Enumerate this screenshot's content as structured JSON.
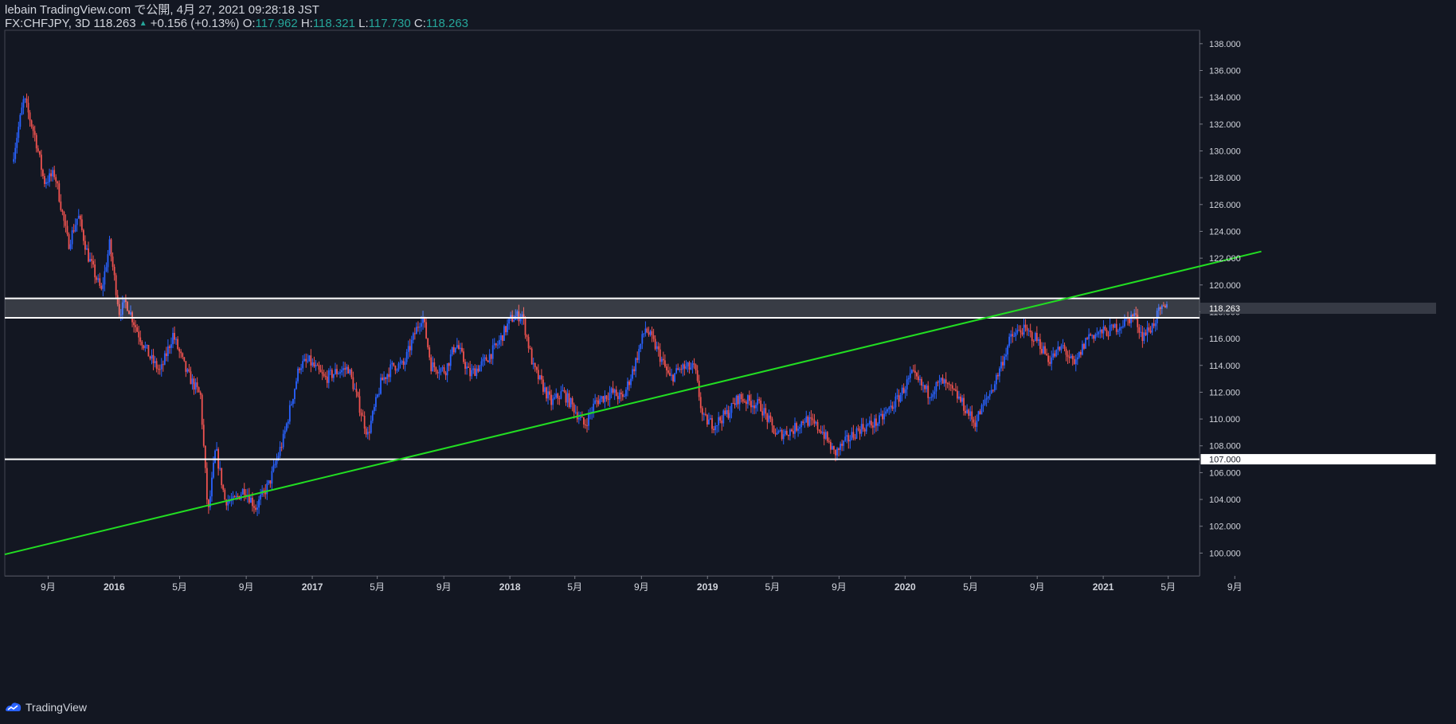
{
  "header": {
    "publish_line": "lebain TradingView.com で公開, 4月 27, 2021 09:28:18 JST",
    "symbol": "FX:CHFJPY, 3D",
    "last": "118.263",
    "change": "+0.156 (+0.13%)",
    "o_label": "O:",
    "o_value": "117.962",
    "h_label": "H:",
    "h_value": "118.321",
    "l_label": "L:",
    "l_value": "117.730",
    "c_label": "C:",
    "c_value": "118.263"
  },
  "brand": {
    "name": "TradingView"
  },
  "colors": {
    "background": "#131722",
    "up": "#2962ff",
    "down": "#ef5350",
    "trendline": "#22dd22",
    "zone": "#ffffff"
  },
  "chart_data": {
    "type": "candlestick",
    "title": "",
    "xlabel": "",
    "ylabel": "",
    "ylim": [
      98.3,
      139.0
    ],
    "y_ticks": [
      "138.000",
      "136.000",
      "134.000",
      "132.000",
      "130.000",
      "128.000",
      "126.000",
      "124.000",
      "122.000",
      "120.000",
      "118.000",
      "116.000",
      "114.000",
      "112.000",
      "110.000",
      "108.000",
      "106.000",
      "104.000",
      "102.000",
      "100.000"
    ],
    "x_ticks": [
      "9月",
      "2016",
      "5月",
      "9月",
      "2017",
      "5月",
      "9月",
      "2018",
      "5月",
      "9月",
      "2019",
      "5月",
      "9月",
      "2020",
      "5月",
      "9月",
      "2021",
      "5月",
      "9月"
    ],
    "x_tick_dates": [
      "2015-09",
      "2016-01",
      "2016-05",
      "2016-09",
      "2017-01",
      "2017-05",
      "2017-09",
      "2018-01",
      "2018-05",
      "2018-09",
      "2019-01",
      "2019-05",
      "2019-09",
      "2020-01",
      "2020-05",
      "2020-09",
      "2021-01",
      "2021-05",
      "2021-09"
    ],
    "price_path": [
      [
        "2015-06-28",
        129.2
      ],
      [
        "2015-07-20",
        133.9
      ],
      [
        "2015-08-10",
        131.0
      ],
      [
        "2015-08-26",
        127.7
      ],
      [
        "2015-09-15",
        128.3
      ],
      [
        "2015-10-10",
        123.0
      ],
      [
        "2015-10-28",
        125.2
      ],
      [
        "2015-11-15",
        122.2
      ],
      [
        "2015-12-10",
        119.5
      ],
      [
        "2015-12-25",
        123.0
      ],
      [
        "2016-01-12",
        118.0
      ],
      [
        "2016-01-25",
        118.7
      ],
      [
        "2016-02-15",
        116.5
      ],
      [
        "2016-03-10",
        114.5
      ],
      [
        "2016-03-28",
        113.5
      ],
      [
        "2016-04-20",
        116.3
      ],
      [
        "2016-05-15",
        113.5
      ],
      [
        "2016-06-10",
        111.7
      ],
      [
        "2016-06-24",
        102.8
      ],
      [
        "2016-07-08",
        107.8
      ],
      [
        "2016-07-25",
        104.0
      ],
      [
        "2016-08-10",
        103.8
      ],
      [
        "2016-08-30",
        104.8
      ],
      [
        "2016-09-20",
        103.4
      ],
      [
        "2016-10-15",
        105.2
      ],
      [
        "2016-11-10",
        108.5
      ],
      [
        "2016-12-10",
        114.0
      ],
      [
        "2016-12-28",
        114.3
      ],
      [
        "2017-01-25",
        113.0
      ],
      [
        "2017-02-15",
        113.5
      ],
      [
        "2017-03-10",
        113.8
      ],
      [
        "2017-04-15",
        108.8
      ],
      [
        "2017-05-10",
        112.8
      ],
      [
        "2017-06-01",
        114.0
      ],
      [
        "2017-06-20",
        114.0
      ],
      [
        "2017-07-12",
        116.5
      ],
      [
        "2017-07-25",
        117.8
      ],
      [
        "2017-08-10",
        114.0
      ],
      [
        "2017-09-05",
        113.6
      ],
      [
        "2017-09-25",
        115.7
      ],
      [
        "2017-10-20",
        113.3
      ],
      [
        "2017-11-15",
        114.2
      ],
      [
        "2017-12-10",
        115.5
      ],
      [
        "2018-01-05",
        117.5
      ],
      [
        "2018-01-25",
        117.8
      ],
      [
        "2018-02-15",
        113.8
      ],
      [
        "2018-03-20",
        111.2
      ],
      [
        "2018-04-10",
        112.0
      ],
      [
        "2018-05-01",
        110.8
      ],
      [
        "2018-05-20",
        109.5
      ],
      [
        "2018-06-10",
        111.3
      ],
      [
        "2018-07-10",
        112.0
      ],
      [
        "2018-07-30",
        111.5
      ],
      [
        "2018-08-20",
        113.9
      ],
      [
        "2018-09-10",
        116.8
      ],
      [
        "2018-09-30",
        115.3
      ],
      [
        "2018-10-25",
        113.0
      ],
      [
        "2018-11-15",
        113.8
      ],
      [
        "2018-12-10",
        113.8
      ],
      [
        "2018-12-25",
        110.0
      ],
      [
        "2019-01-15",
        109.6
      ],
      [
        "2019-02-10",
        110.5
      ],
      [
        "2019-03-01",
        111.6
      ],
      [
        "2019-04-10",
        111.0
      ],
      [
        "2019-05-10",
        108.8
      ],
      [
        "2019-06-10",
        109.2
      ],
      [
        "2019-07-01",
        110.0
      ],
      [
        "2019-08-01",
        109.2
      ],
      [
        "2019-08-25",
        107.4
      ],
      [
        "2019-09-15",
        108.3
      ],
      [
        "2019-10-10",
        109.3
      ],
      [
        "2019-11-15",
        109.8
      ],
      [
        "2019-12-20",
        111.5
      ],
      [
        "2020-01-15",
        113.3
      ],
      [
        "2020-02-15",
        111.9
      ],
      [
        "2020-03-10",
        112.8
      ],
      [
        "2020-04-10",
        111.6
      ],
      [
        "2020-05-10",
        109.7
      ],
      [
        "2020-06-15",
        112.6
      ],
      [
        "2020-07-15",
        116.0
      ],
      [
        "2020-08-05",
        116.7
      ],
      [
        "2020-09-01",
        116.0
      ],
      [
        "2020-09-25",
        114.4
      ],
      [
        "2020-10-20",
        115.4
      ],
      [
        "2020-11-10",
        113.9
      ],
      [
        "2020-12-05",
        116.2
      ],
      [
        "2021-01-15",
        116.6
      ],
      [
        "2021-02-10",
        117.2
      ],
      [
        "2021-03-01",
        117.8
      ],
      [
        "2021-03-15",
        116.2
      ],
      [
        "2021-04-01",
        116.8
      ],
      [
        "2021-04-15",
        117.9
      ],
      [
        "2021-04-27",
        118.263
      ]
    ],
    "horizontal_lines": [
      119.0,
      117.55,
      107.0
    ],
    "zone": [
      117.55,
      119.0
    ],
    "trendline": {
      "from": [
        "2015-06-13",
        99.9
      ],
      "to": [
        "2021-10-20",
        122.5
      ]
    },
    "price_labels": [
      {
        "value": 118.263,
        "text": "118.263",
        "style": "last"
      },
      {
        "value": 107.0,
        "text": "107.000",
        "style": "white"
      }
    ]
  }
}
